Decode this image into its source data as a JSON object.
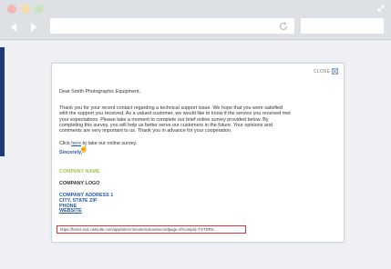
{
  "dialog": {
    "close_label": "CLOSE",
    "greeting": "Dear Smith Photographic Equipment,",
    "body_lines": [
      "Thank you for your recent contact regarding a technical support issue. We hope that you were satisfied",
      "with the support you received. As a valued customer, we would like to know if the service you received met",
      "your expectations. Please take a moment to complete our brief online survey provided below. By",
      "completing this survey, you will help us better serve our customers in the future. Your opinions and",
      "comments are very important to us. Thank you in advance for your cooperation."
    ],
    "click_prefix": "Click ",
    "click_link": "here",
    "click_suffix": " to take our online survey.",
    "sincerely": "Sincerely,",
    "company_name": "COMPANY NAME",
    "company_logo": "COMPANY LOGO",
    "address_line1": "COMPANY ADDRESS 1",
    "address_line2": "CITY, STATE ZIP",
    "phone": "PHONE",
    "website": "WEBSITE"
  },
  "status_bar": {
    "url": "https://forms.na1.netsuite.com/app/site/crm/externalcustrecordpage.nl?compid=TSTDRV..."
  }
}
